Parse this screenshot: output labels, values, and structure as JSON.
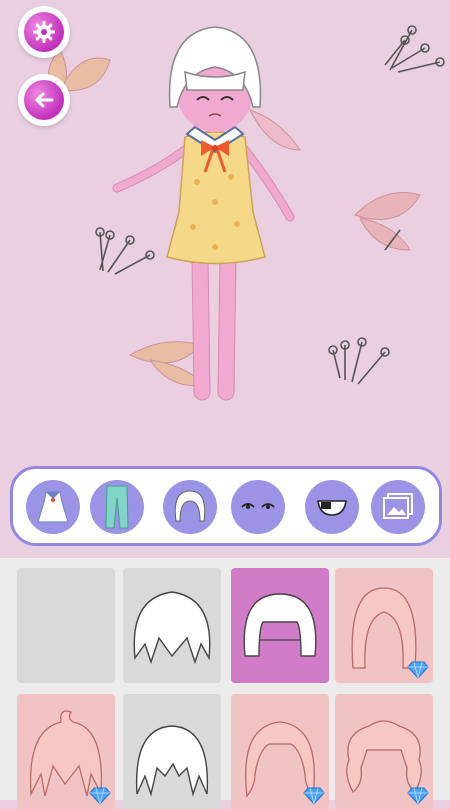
{
  "icons": {
    "settings": "gear-icon",
    "back": "back-arrow-icon",
    "premium": "diamond-icon"
  },
  "colors": {
    "background": "#e9cfe0",
    "accent": "#c22fbd",
    "category_button": "#9a93e6",
    "category_border": "#9189e0",
    "selected_tile": "#d07cc8"
  },
  "categories": [
    {
      "id": "dress",
      "icon": "dress-icon"
    },
    {
      "id": "pants",
      "icon": "pants-icon"
    },
    {
      "id": "hair",
      "icon": "hair-icon"
    },
    {
      "id": "eyes",
      "icon": "eyes-icon"
    },
    {
      "id": "mouth",
      "icon": "mouth-icon"
    },
    {
      "id": "background",
      "icon": "gallery-icon"
    }
  ],
  "hair_options": [
    {
      "id": "none",
      "premium": false,
      "selected": false
    },
    {
      "id": "white-layered",
      "premium": false,
      "selected": false
    },
    {
      "id": "white-bob",
      "premium": false,
      "selected": true
    },
    {
      "id": "pink-long",
      "premium": true,
      "selected": false
    },
    {
      "id": "pink-spiky",
      "premium": true,
      "selected": false
    },
    {
      "id": "white-straight",
      "premium": false,
      "selected": false
    },
    {
      "id": "pink-wavy",
      "premium": true,
      "selected": false
    },
    {
      "id": "pink-curly",
      "premium": true,
      "selected": false
    }
  ]
}
